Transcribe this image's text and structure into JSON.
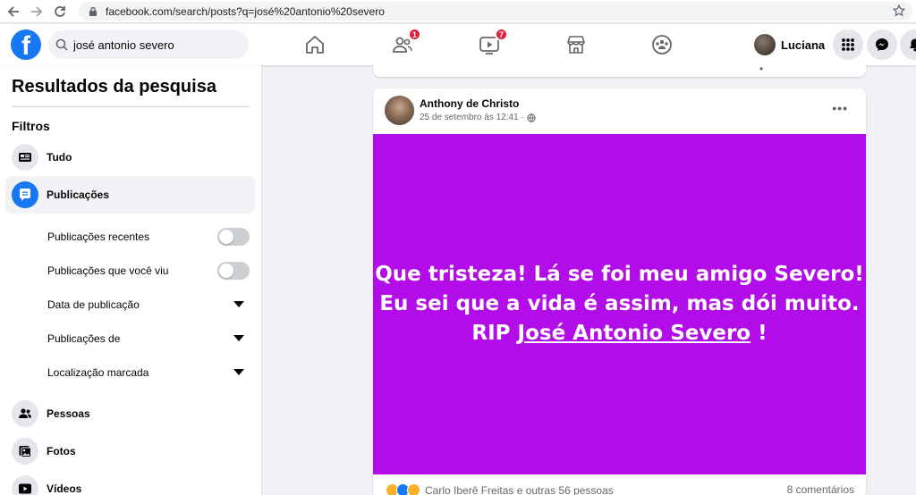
{
  "browser": {
    "url": "facebook.com/search/posts?q=josé%20antonio%20severo"
  },
  "header": {
    "logo": "f",
    "search_value": "josé antonio severo",
    "friends_badge": "1",
    "watch_badge": "7",
    "profile_name": "Luciana"
  },
  "sidebar": {
    "title": "Resultados da pesquisa",
    "filters_label": "Filtros",
    "items": [
      {
        "label": "Tudo",
        "icon": "feed-icon"
      },
      {
        "label": "Publicações",
        "icon": "posts-icon"
      },
      {
        "label": "Pessoas",
        "icon": "people-icon"
      },
      {
        "label": "Fotos",
        "icon": "photos-icon"
      },
      {
        "label": "Vídeos",
        "icon": "video-icon"
      }
    ],
    "sub_items": [
      {
        "label": "Publicações recentes",
        "control": "toggle"
      },
      {
        "label": "Publicações que você viu",
        "control": "toggle"
      },
      {
        "label": "Data de publicação",
        "control": "dropdown"
      },
      {
        "label": "Publicações de",
        "control": "dropdown"
      },
      {
        "label": "Localização marcada",
        "control": "dropdown"
      }
    ]
  },
  "post": {
    "author": "Anthony de Christo",
    "timestamp": "25 de setembro às 12:41",
    "privacy_icon": "globe-icon",
    "background_color": "#b20ce8",
    "line1": "Que tristeza! Lá se foi meu amigo Severo!",
    "line2": "Eu sei que a vida é assim, mas dói muito.",
    "line3_prefix": "RIP ",
    "line3_mention": "José Antonio Severo",
    "line3_suffix": " !",
    "reactions_text": "Carlo Iberê Freitas e outras 56 pessoas",
    "comments_text": "8 comentários"
  },
  "colors": {
    "brand": "#1877f2",
    "badge": "#e41e3f"
  }
}
